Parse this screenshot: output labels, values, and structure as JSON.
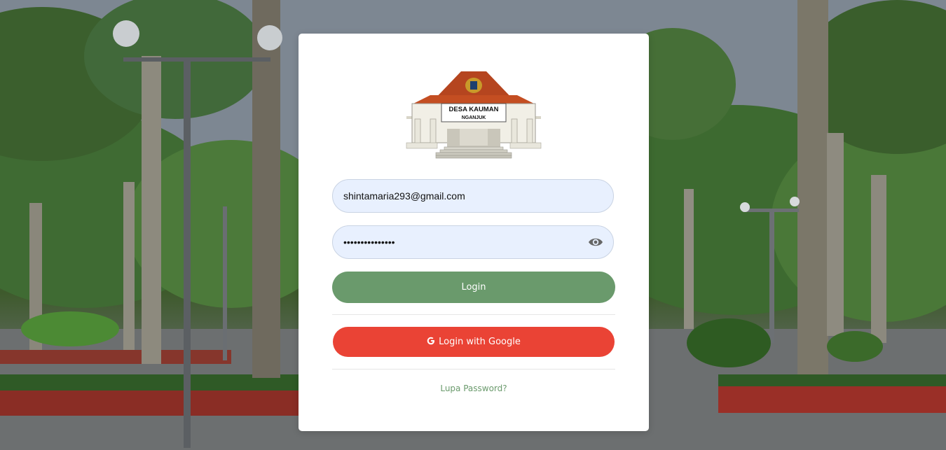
{
  "background": {
    "scene": "park-with-palm-trees-and-street-lamps"
  },
  "logo": {
    "line1": "DESA KAUMAN",
    "line2": "NGANJUK",
    "emblem_icon": "garuda-emblem-icon"
  },
  "form": {
    "email_value": "shintamaria293@gmail.com",
    "password_value": "shintamaria2934",
    "password_toggle_icon": "eye-icon",
    "login_label": "Login",
    "google_label": "Login with Google",
    "google_icon": "google-g-icon",
    "forgot_label": "Lupa Password?"
  },
  "colors": {
    "login_button": "#6a9a6c",
    "google_button": "#ea4335",
    "field_background": "#e8f0fe",
    "link": "#6a9a6c"
  }
}
